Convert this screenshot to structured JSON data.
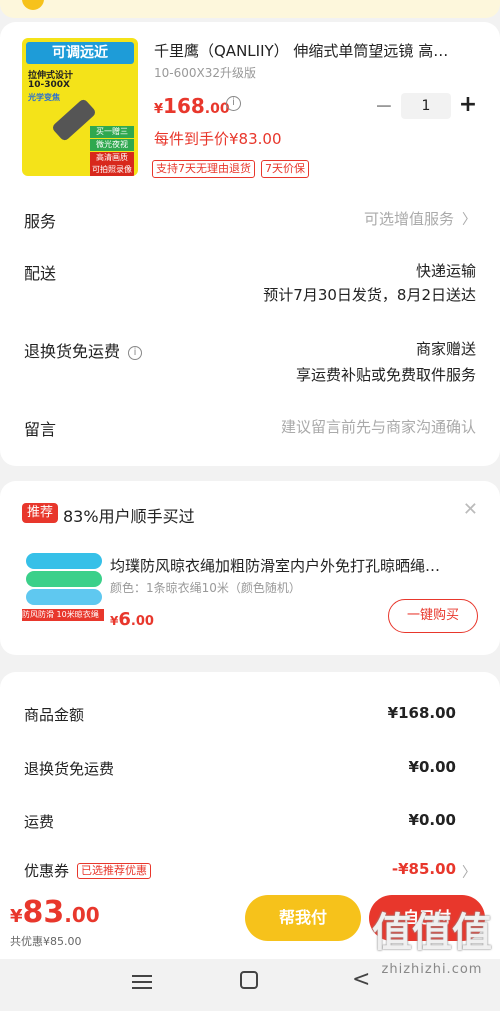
{
  "product": {
    "title": "千里鹰（QANLIIY） 伸缩式单筒望远镜 高…",
    "spec": "10-600X32升级版",
    "price_currency": "¥",
    "price_int": "168",
    "price_dec": ".00",
    "per_price": "每件到手价¥83.00",
    "quantity": "1",
    "badges": [
      "支持7天无理由退货",
      "7天价保"
    ],
    "image_text": {
      "headline": "可调远近",
      "line1": "拉伸式设计",
      "line2": "10-300X",
      "line3": "光学变焦",
      "feature1": "买一赠三",
      "feature2": "微光夜视",
      "feature3": "高清画质",
      "feature4": "可拍照录像"
    }
  },
  "rows": {
    "service_label": "服务",
    "service_value": "可选增值服务",
    "delivery_label": "配送",
    "delivery_method": "快递运输",
    "delivery_time": "预计7月30日发货，8月2日送达",
    "return_label": "退换货免运费",
    "return_value1": "商家赠送",
    "return_value2": "享运费补贴或免费取件服务",
    "message_label": "留言",
    "message_placeholder": "建议留言前先与商家沟通确认"
  },
  "recommend": {
    "tag": "推荐",
    "heading": "83%用户顺手买过",
    "title": "均璞防风晾衣绳加粗防滑室内户外免打孔晾晒绳…",
    "spec": "颜色：1条晾衣绳10米（颜色随机）",
    "price_currency": "¥",
    "price_int": "6",
    "price_dec": ".00",
    "buy_label": "一键购买",
    "image_label": "防风防滑 10米晾衣绳"
  },
  "summary": {
    "goods_label": "商品金额",
    "goods_value": "¥168.00",
    "return_label": "退换货免运费",
    "return_value": "¥0.00",
    "shipping_label": "运费",
    "shipping_value": "¥0.00",
    "coupon_label": "优惠券",
    "coupon_tag": "已选推荐优惠",
    "coupon_value": "-¥85.00"
  },
  "bottom": {
    "total_currency": "¥",
    "total_int": "83",
    "total_dec": ".00",
    "total_sub": "共优惠¥85.00",
    "help_pay": "帮我付",
    "self_pay": "自己付"
  },
  "watermark": {
    "glyphs": "值值值",
    "site": "zhizhizhi.com"
  },
  "colors": {
    "accent_red": "#e8372c",
    "accent_yellow": "#f6c21b"
  }
}
